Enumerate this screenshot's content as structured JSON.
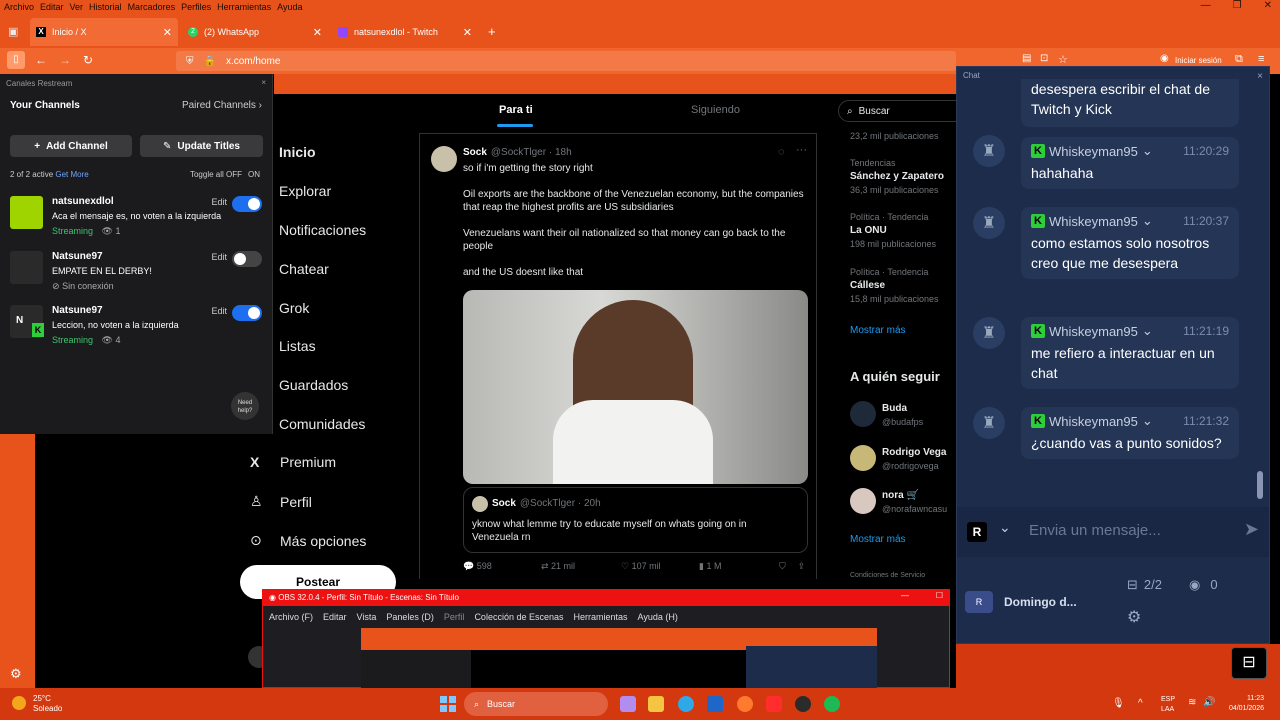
{
  "browser": {
    "menu": [
      "Archivo",
      "Editar",
      "Ver",
      "Historial",
      "Marcadores",
      "Perfiles",
      "Herramientas",
      "Ayuda"
    ],
    "tabs": [
      {
        "label": "Inicio / X"
      },
      {
        "label": "(2) WhatsApp"
      },
      {
        "label": "natsunexdlol - Twitch"
      }
    ],
    "url": "x.com/home",
    "signin": "Iniciar sesión"
  },
  "restream": {
    "header": "Canales Restream",
    "your_channels": "Your Channels",
    "paired_channels": "Paired Channels",
    "add_channel": "Add Channel",
    "update_titles": "Update Titles",
    "active_count": "2 of 2 active",
    "get_more": "Get More",
    "toggle_all": "Toggle all OFF",
    "on": "ON",
    "need_help": "Need help?",
    "channels": [
      {
        "name": "natsunexdlol",
        "message": "Aca el mensaje es, no voten a la izquierda",
        "status": "Streaming",
        "viewers": "1",
        "enabled": true,
        "edit": "Edit"
      },
      {
        "name": "Natsune97",
        "message": "EMPATE EN EL DERBY!",
        "status": "Sin conexión",
        "viewers": "",
        "enabled": false,
        "edit": "Edit"
      },
      {
        "name": "Natsune97",
        "message": "Leccion, no voten a la izquierda",
        "status": "Streaming",
        "viewers": "4",
        "enabled": true,
        "edit": "Edit",
        "initial": "N"
      }
    ]
  },
  "x": {
    "nav": [
      "Inicio",
      "Explorar",
      "Notificaciones",
      "Chatear",
      "Grok",
      "Listas",
      "Guardados",
      "Comunidades",
      "Premium",
      "Perfil",
      "Más opciones"
    ],
    "post_button": "Postear",
    "feed_tabs": [
      "Para ti",
      "Siguiendo"
    ],
    "tweet": {
      "author": "Sock",
      "handle": "@SockTlger · 18h",
      "lines": [
        "so if i'm getting the story right",
        "Oil exports are the backbone of the Venezuelan economy, but the companies that reap the highest profits are US subsidiaries",
        "Venezuelans want their oil nationalized so that money can go back to the people",
        "and the US doesnt like that"
      ],
      "quote_author": "Sock",
      "quote_handle": "@SockTlger · 20h",
      "quote_text": "yknow what lemme try to educate myself on whats going on in Venezuela rn",
      "stats": {
        "replies": "598",
        "retweets": "21 mil",
        "likes": "107 mil",
        "views": "1 M"
      }
    },
    "search_placeholder": "Buscar",
    "trends": [
      {
        "meta": "",
        "title": "",
        "count": "23,2 mil publicaciones"
      },
      {
        "meta": "Tendencias",
        "title": "Sánchez y Zapatero",
        "count": "36,3 mil publicaciones"
      },
      {
        "meta": "Política · Tendencia",
        "title": "La ONU",
        "count": "198 mil publicaciones"
      },
      {
        "meta": "Política · Tendencia",
        "title": "Cállese",
        "count": "15,8 mil publicaciones"
      }
    ],
    "show_more": "Mostrar más",
    "who_to_follow": "A quién seguir",
    "follow": [
      {
        "name": "Buda",
        "handle": "@budafps"
      },
      {
        "name": "Rodrigo Vega",
        "handle": "@rodrigovega"
      },
      {
        "name": "nora 🛒",
        "handle": "@norafawncasu"
      }
    ],
    "show_more2": "Mostrar más",
    "footer": "Condiciones de Servicio"
  },
  "chat": {
    "title": "Chat",
    "top_text": "desespera escribir el chat de Twitch y Kick",
    "messages": [
      {
        "user": "Whiskeyman95",
        "time": "11:20:29",
        "text": "hahahaha"
      },
      {
        "user": "Whiskeyman95",
        "time": "11:20:37",
        "text": "como estamos solo nosotros creo que me desespera"
      },
      {
        "user": "Whiskeyman95",
        "time": "11:21:19",
        "text": "me refiero a interactuar en un chat"
      },
      {
        "user": "Whiskeyman95",
        "time": "11:21:32",
        "text": "¿cuando vas a punto sonidos?"
      }
    ],
    "input_placeholder": "Envia un mensaje...",
    "bottom_name": "Domingo d...",
    "channels": "2/2",
    "viewers": "0"
  },
  "obs": {
    "title": "OBS 32.0.4 - Perfil: Sin Título - Escenas: Sin Título",
    "menu": [
      "Archivo (F)",
      "Editar",
      "Vista",
      "Paneles (D)",
      "Perfil",
      "Colección de Escenas",
      "Herramientas",
      "Ayuda (H)"
    ]
  },
  "taskbar": {
    "weather_temp": "25°C",
    "weather_desc": "Soleado",
    "search": "Buscar",
    "lang": "ESP",
    "lang2": "LAA",
    "time": "11:23",
    "date": "04/01/2026"
  },
  "colors": {
    "accent": "#e8531c",
    "chat_bg": "#1d2c4a",
    "toggle_on": "#1d6ff0",
    "kick_green": "#2ece3a"
  }
}
